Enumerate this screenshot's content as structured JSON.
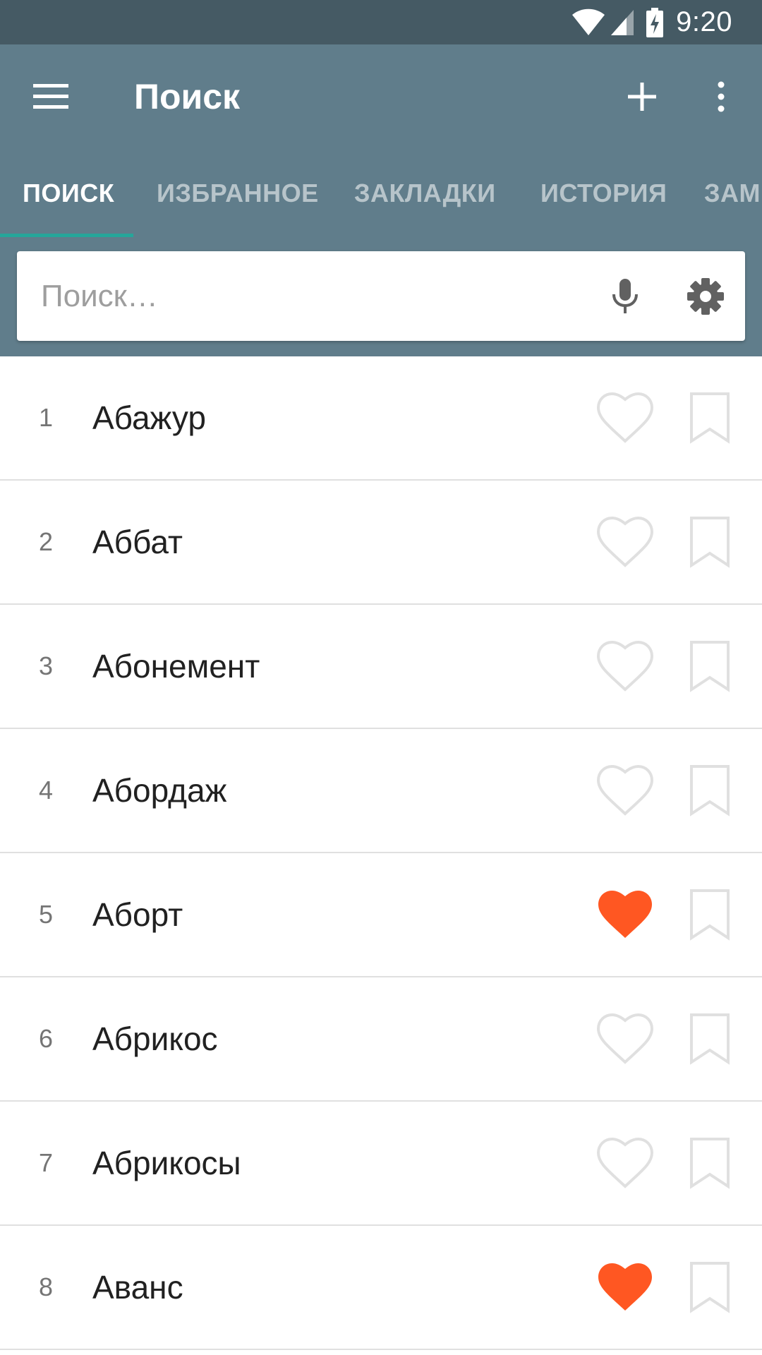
{
  "status_bar": {
    "time": "9:20",
    "icons": [
      "wifi-icon",
      "cell-signal-icon",
      "battery-charging-icon"
    ]
  },
  "app_bar": {
    "title": "Поиск",
    "icons": [
      "menu-icon",
      "plus-icon",
      "more-vert-icon"
    ]
  },
  "tabs": [
    {
      "label": "ПОИСК",
      "active": true
    },
    {
      "label": "ИЗБРАННОЕ",
      "active": false
    },
    {
      "label": "ЗАКЛАДКИ",
      "active": false
    },
    {
      "label": "ИСТОРИЯ",
      "active": false
    },
    {
      "label": "ЗАМ",
      "active": false
    }
  ],
  "search": {
    "placeholder": "Поиск…",
    "value": "",
    "icons": [
      "mic-icon",
      "gear-icon"
    ]
  },
  "colors": {
    "status_bar": "#455a64",
    "app_bar": "#607d8b",
    "tab_indicator": "#26a69a",
    "favorite_active": "#ff5722",
    "icon_inactive": "#e0e0e0"
  },
  "words": [
    {
      "number": "1",
      "word": "Абажур",
      "favorite": false,
      "bookmarked": false
    },
    {
      "number": "2",
      "word": "Аббат",
      "favorite": false,
      "bookmarked": false
    },
    {
      "number": "3",
      "word": "Абонемент",
      "favorite": false,
      "bookmarked": false
    },
    {
      "number": "4",
      "word": "Абордаж",
      "favorite": false,
      "bookmarked": false
    },
    {
      "number": "5",
      "word": "Аборт",
      "favorite": true,
      "bookmarked": false
    },
    {
      "number": "6",
      "word": "Абрикос",
      "favorite": false,
      "bookmarked": false
    },
    {
      "number": "7",
      "word": "Абрикосы",
      "favorite": false,
      "bookmarked": false
    },
    {
      "number": "8",
      "word": "Аванс",
      "favorite": true,
      "bookmarked": false
    }
  ]
}
